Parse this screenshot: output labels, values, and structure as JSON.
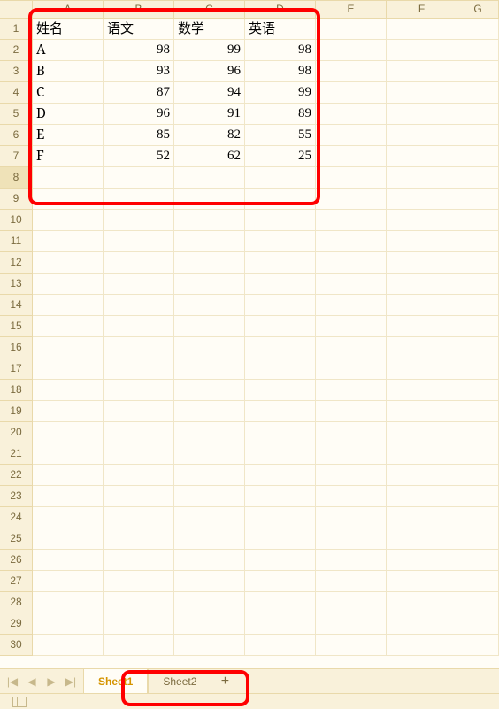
{
  "columns": [
    "A",
    "B",
    "C",
    "D",
    "E",
    "F",
    "G"
  ],
  "row_labels": [
    1,
    2,
    3,
    4,
    5,
    6,
    7,
    8,
    9,
    10,
    11,
    12,
    13,
    14,
    15,
    16,
    17,
    18,
    19,
    20,
    21,
    22,
    23,
    24,
    25,
    26,
    27,
    28,
    29,
    30
  ],
  "selected_row": 8,
  "data": {
    "headers": [
      "姓名",
      "语文",
      "数学",
      "英语"
    ],
    "rows": [
      {
        "name": "A",
        "scores": [
          98,
          99,
          98
        ]
      },
      {
        "name": "B",
        "scores": [
          93,
          96,
          98
        ]
      },
      {
        "name": "C",
        "scores": [
          87,
          94,
          99
        ]
      },
      {
        "name": "D",
        "scores": [
          96,
          91,
          89
        ]
      },
      {
        "name": "E",
        "scores": [
          85,
          82,
          55
        ]
      },
      {
        "name": "F",
        "scores": [
          52,
          62,
          25
        ]
      }
    ]
  },
  "tabs": {
    "active": "Sheet1",
    "inactive": [
      "Sheet2"
    ],
    "add_label": "+"
  },
  "nav_icons": [
    "first",
    "prev",
    "next",
    "last"
  ],
  "chart_data": {
    "type": "table",
    "columns": [
      "姓名",
      "语文",
      "数学",
      "英语"
    ],
    "rows": [
      [
        "A",
        98,
        99,
        98
      ],
      [
        "B",
        93,
        96,
        98
      ],
      [
        "C",
        87,
        94,
        99
      ],
      [
        "D",
        96,
        91,
        89
      ],
      [
        "E",
        85,
        82,
        55
      ],
      [
        "F",
        52,
        62,
        25
      ]
    ]
  }
}
